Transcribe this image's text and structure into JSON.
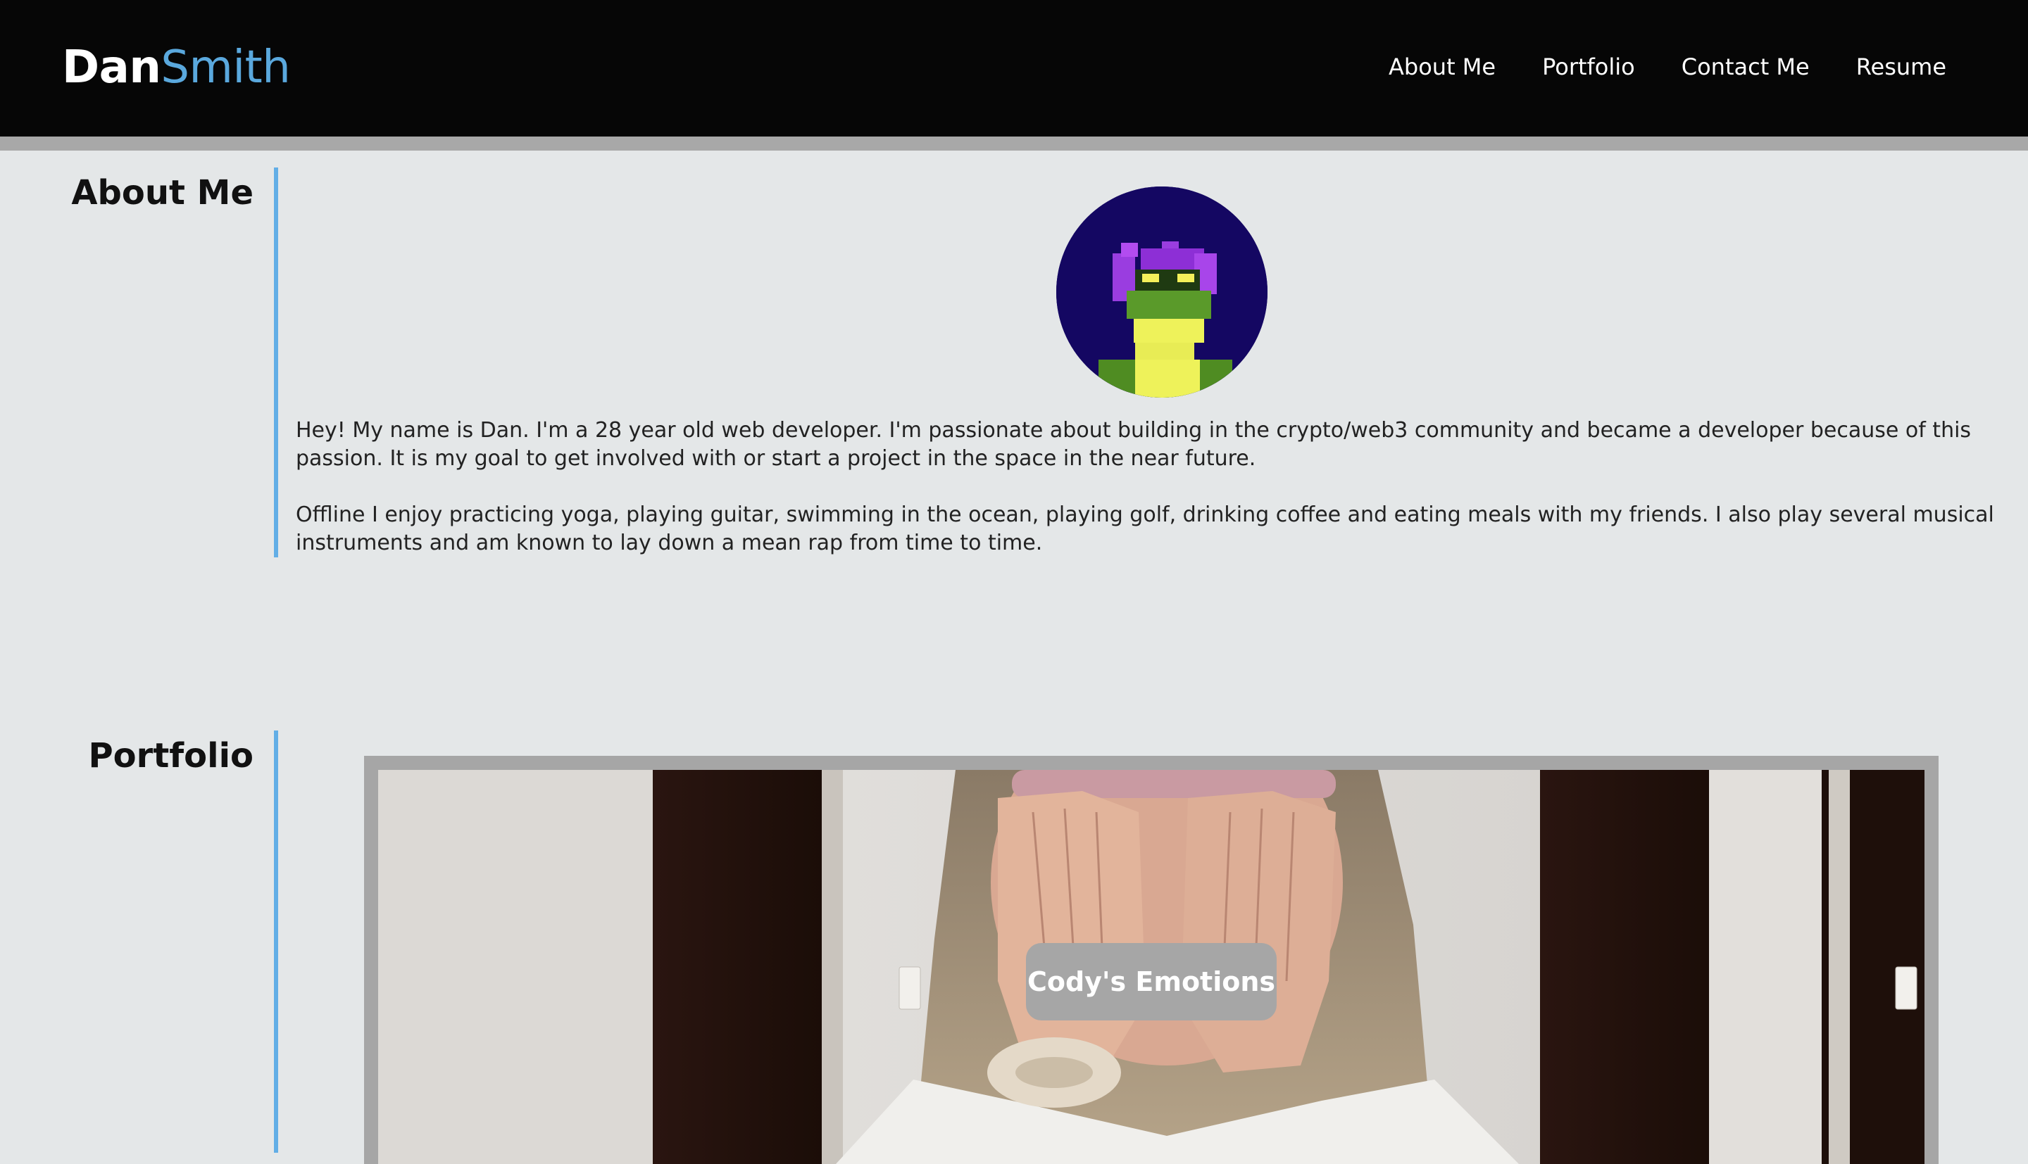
{
  "header": {
    "brand_first": "Dan",
    "brand_last": "Smith",
    "nav": [
      {
        "label": "About Me"
      },
      {
        "label": "Portfolio"
      },
      {
        "label": "Contact Me"
      },
      {
        "label": "Resume"
      }
    ]
  },
  "about": {
    "title": "About Me",
    "paragraphs": [
      "Hey! My name is Dan. I'm a 28 year old web developer. I'm passionate about building in the crypto/web3 community and became a developer because of this passion. It is my goal to get involved with or start a project in the space in the near future.",
      "Offline I enjoy practicing yoga, playing guitar, swimming in the ocean, playing golf, drinking coffee and eating meals with my friends. I also play several musical instruments and am known to lay down a mean rap from time to time."
    ]
  },
  "portfolio": {
    "title": "Portfolio",
    "projects": [
      {
        "label": "Cody's Emotions"
      }
    ]
  },
  "colors": {
    "header_bg": "#060606",
    "brand_accent": "#5aa8dd",
    "section_bar": "#62aee6",
    "page_bg": "#e4e7e8",
    "card_frame": "#a6a6a6"
  }
}
